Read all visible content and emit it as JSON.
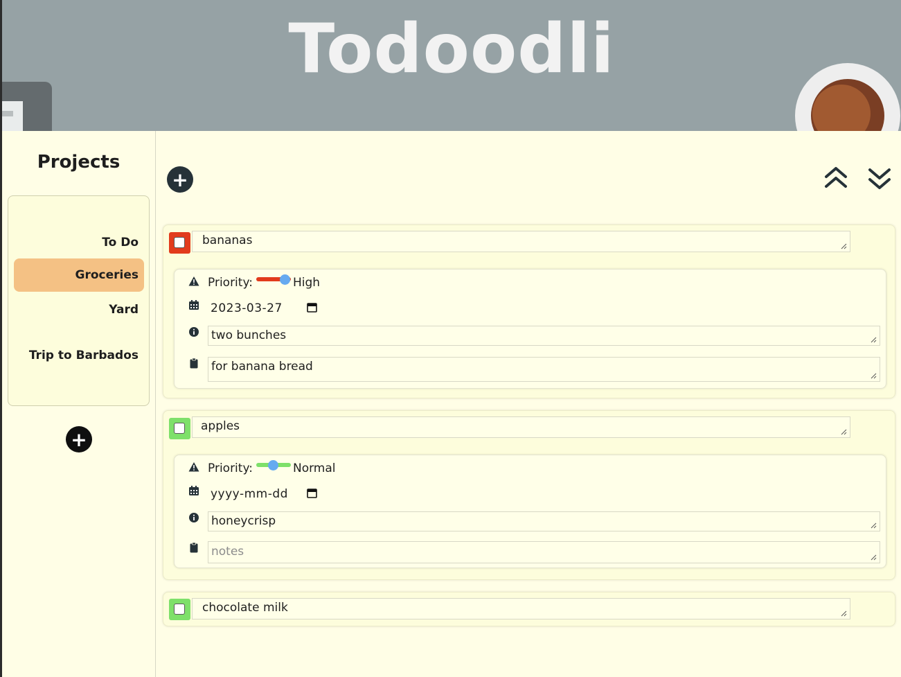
{
  "app": {
    "title": "Todoodli"
  },
  "sidebar": {
    "title": "Projects",
    "projects": [
      {
        "label": "To Do",
        "active": false
      },
      {
        "label": "Groceries",
        "active": true
      },
      {
        "label": "Yard",
        "active": false
      },
      {
        "label": "Trip to Barbados",
        "active": false
      }
    ],
    "add_project_label": "+"
  },
  "toolbar": {
    "add_task_label": "+"
  },
  "tasks": [
    {
      "name": "bananas",
      "status_color": "#e23b1c",
      "priority_label": "Priority:",
      "priority_value": "High",
      "priority_level": 1.0,
      "date": "2023-03-27",
      "description": "two bunches",
      "notes": "for banana bread"
    },
    {
      "name": "apples",
      "status_color": "#7ee06a",
      "priority_label": "Priority:",
      "priority_value": "Normal",
      "priority_level": 0.5,
      "date": "yyyy-mm-dd",
      "description": "honeycrisp",
      "notes_placeholder": "notes"
    },
    {
      "name": "chocolate milk",
      "status_color": "#7ee06a"
    }
  ],
  "colors": {
    "header_bg": "#96a2a5",
    "page_bg": "#fffee6",
    "active_project": "#f4c184",
    "high_priority": "#e23b1c",
    "normal_priority": "#7ee06a",
    "slider_thumb": "#66aaf0"
  }
}
